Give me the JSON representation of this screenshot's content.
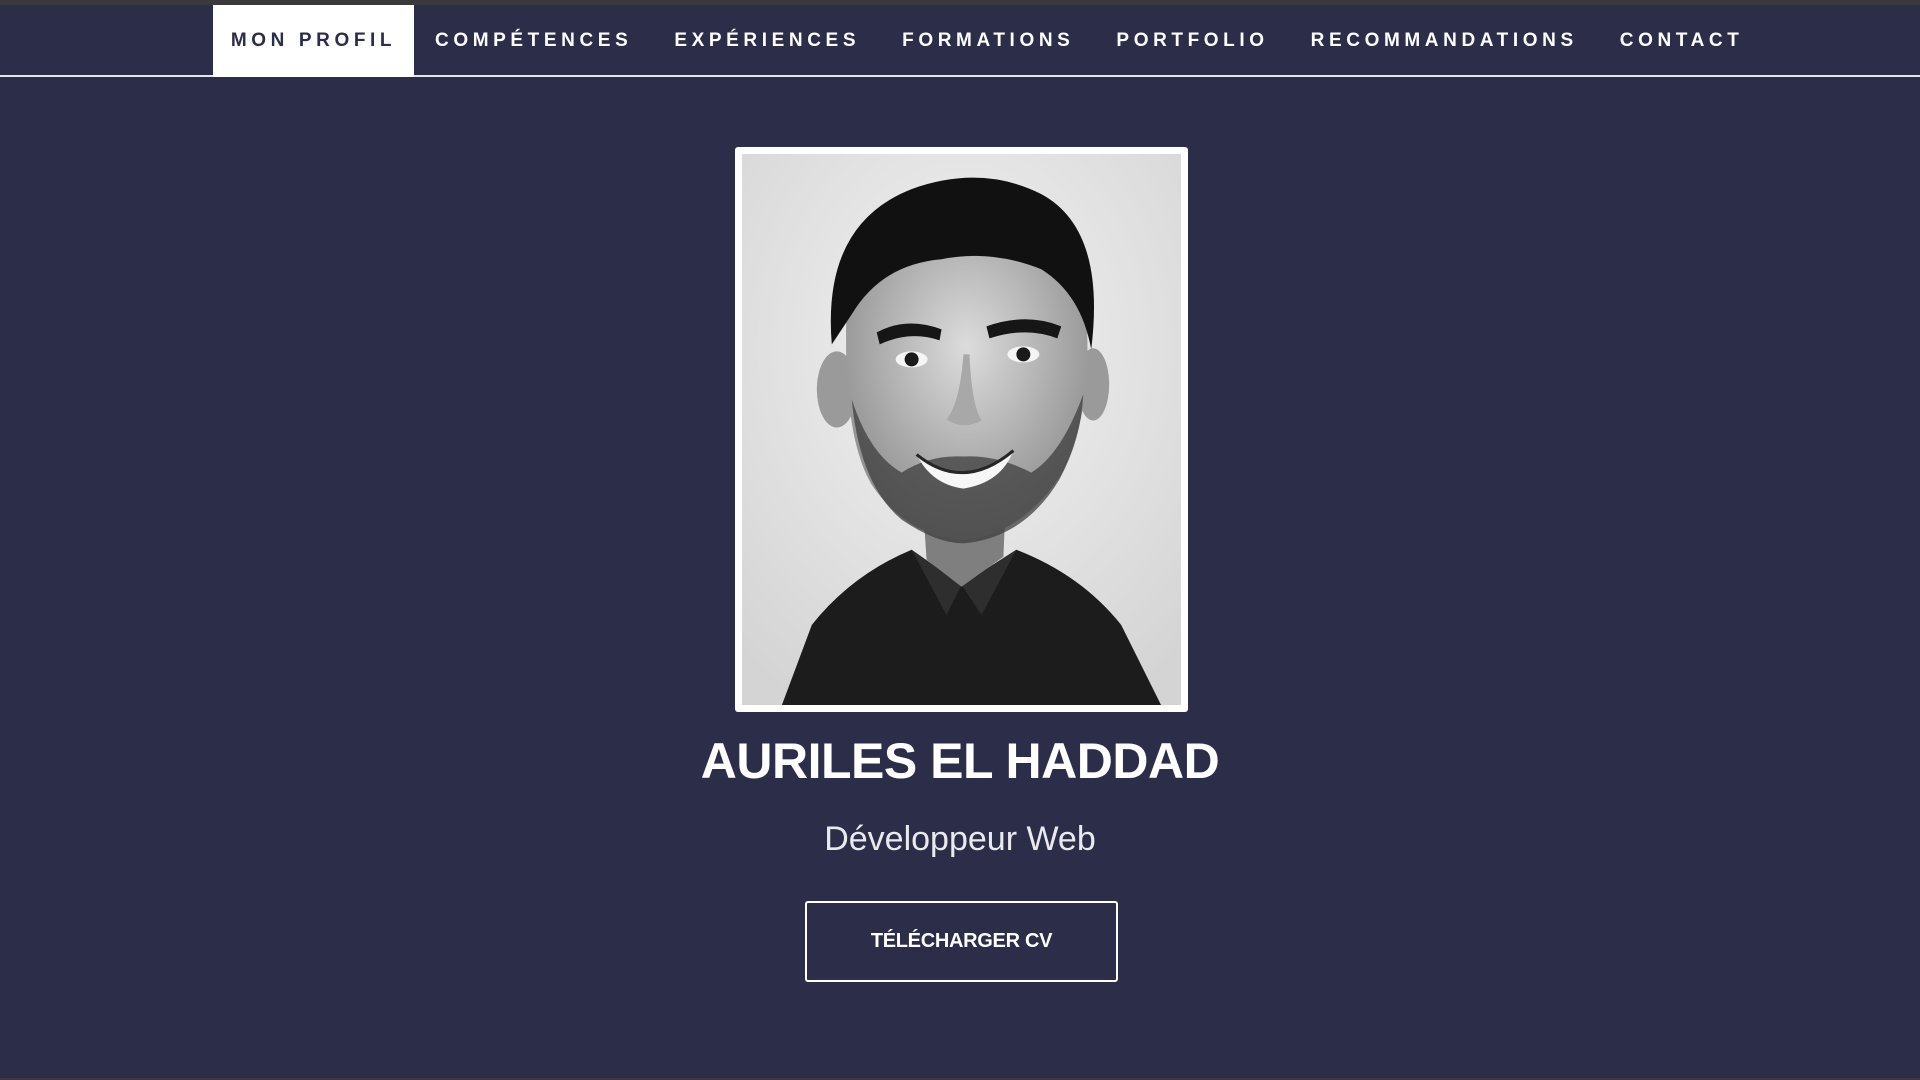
{
  "nav": {
    "items": [
      {
        "label": "MON PROFIL",
        "active": true
      },
      {
        "label": "COMPÉTENCES",
        "active": false
      },
      {
        "label": "EXPÉRIENCES",
        "active": false
      },
      {
        "label": "FORMATIONS",
        "active": false
      },
      {
        "label": "PORTFOLIO",
        "active": false
      },
      {
        "label": "RECOMMANDATIONS",
        "active": false
      },
      {
        "label": "CONTACT",
        "active": false
      }
    ]
  },
  "profile": {
    "name": "AURILES EL HADDAD",
    "role": "Développeur Web",
    "cv_button": "TÉLÉCHARGER CV",
    "photo_style": "black-and-white portrait"
  },
  "colors": {
    "background": "#2c2e49",
    "text": "#ffffff",
    "nav_active_bg": "#ffffff",
    "nav_active_text": "#2c2e49"
  }
}
